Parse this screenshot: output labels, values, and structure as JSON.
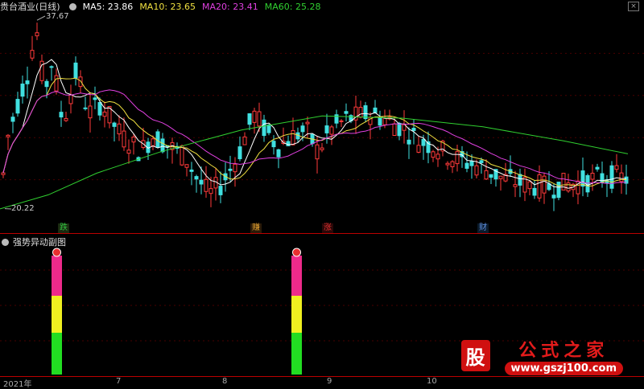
{
  "header": {
    "title": "贵台酒业(日线)",
    "ma": [
      {
        "label": "MA5: 23.86",
        "color": "#ffffff"
      },
      {
        "label": "MA10: 23.65",
        "color": "#f0e040"
      },
      {
        "label": "MA20: 23.41",
        "color": "#e040e0"
      },
      {
        "label": "MA60: 25.28",
        "color": "#30d030"
      }
    ]
  },
  "price_labels": {
    "high": "37.67",
    "low": "20.22"
  },
  "events": [
    {
      "label": "跌",
      "color": "#30c040",
      "bg": "#1a2a10"
    },
    {
      "label": "赚",
      "color": "#e0a030",
      "bg": "#2a1a08"
    },
    {
      "label": "涨",
      "color": "#e03030",
      "bg": "#2a0808"
    },
    {
      "label": "财",
      "color": "#6090e0",
      "bg": "#0a1a2a"
    }
  ],
  "indicator": {
    "title": "强势异动副图"
  },
  "axis_labels": [
    "2021年",
    "7",
    "8",
    "9",
    "10"
  ],
  "watermark": {
    "logo": "股",
    "title": "公式之家",
    "url": "www.gszj100.com"
  },
  "chart_data": {
    "type": "candlestick",
    "symbol": "贵台酒业",
    "period": "日线",
    "price_range": [
      19.0,
      38.5
    ],
    "high_marker": 37.67,
    "low_marker": 20.22,
    "moving_averages": {
      "MA5": 23.86,
      "MA10": 23.65,
      "MA20": 23.41,
      "MA60": 25.28
    },
    "indicator_bars": [
      {
        "segments": [
          "green",
          "yellow",
          "magenta"
        ]
      },
      {
        "segments": [
          "green",
          "yellow",
          "magenta"
        ]
      }
    ]
  }
}
